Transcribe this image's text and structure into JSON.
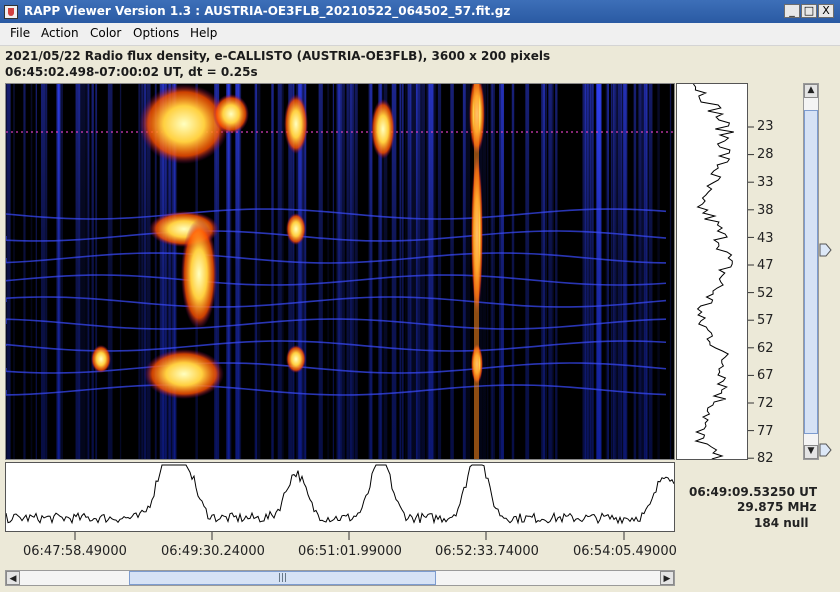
{
  "window": {
    "title": "RAPP Viewer Version 1.3 : AUSTRIA-OE3FLB_20210522_064502_57.fit.gz",
    "minimize_label": "_",
    "maximize_label": "□",
    "close_label": "X"
  },
  "menu": {
    "items": [
      {
        "label": "File"
      },
      {
        "label": "Action"
      },
      {
        "label": "Color"
      },
      {
        "label": "Options"
      },
      {
        "label": "Help"
      }
    ]
  },
  "info": {
    "line1": "2021/05/22  Radio flux density, e-CALLISTO (AUSTRIA-OE3FLB),  3600 x 200 pixels",
    "line2": "06:45:02.498-07:00:02 UT,  dt = 0.25s"
  },
  "y_axis": {
    "ticks": [
      "23",
      "28",
      "33",
      "38",
      "43",
      "47",
      "52",
      "57",
      "62",
      "67",
      "72",
      "77",
      "82"
    ]
  },
  "x_axis": {
    "ticks": [
      "06:47:58.49000",
      "06:49:30.24000",
      "06:51:01.99000",
      "06:52:33.74000",
      "06:54:05.49000"
    ]
  },
  "readout": {
    "time": "06:49:09.53250 UT",
    "freq": "29.875 MHz",
    "value": "184 null"
  },
  "vertical_scroll": {
    "thumb_fraction": 0.48,
    "thumb_size_fraction": 0.93
  },
  "horizontal_scroll": {
    "thumb_fraction": 0.17,
    "thumb_size_fraction": 0.48
  },
  "colors": {
    "background": "#000000",
    "burst_hot": "#ffff9a",
    "burst_mid": "#ff6a00",
    "band_blue": "#2233ff"
  }
}
